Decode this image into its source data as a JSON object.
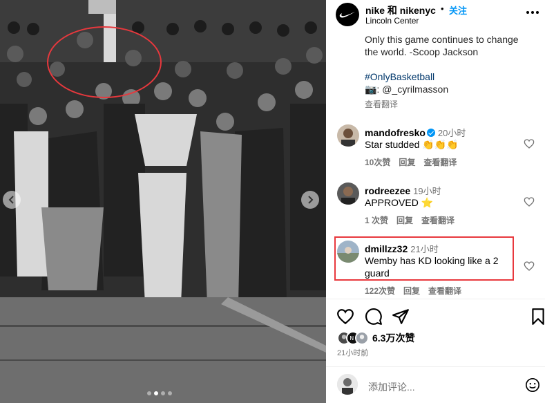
{
  "post": {
    "account": "nike 和 nikenyc",
    "separator": "•",
    "follow_label": "关注",
    "location": "Lincoln Center",
    "caption_lines": [
      "Only this game continues to change",
      "the world. -Scoop Jackson"
    ],
    "hashtag": "#OnlyBasketball",
    "photo_credit": "📷: @_cyrilmasson",
    "see_translation": "查看翻译"
  },
  "comments": [
    {
      "username": "mandofresko",
      "verified": true,
      "time": "20小时",
      "text": "Star studded 👏👏👏",
      "likes": "10次赞",
      "reply": "回复",
      "translate": "查看翻译"
    },
    {
      "username": "rodreezee",
      "verified": false,
      "time": "19小时",
      "text": "APPROVED ⭐",
      "likes": "1 次赞",
      "reply": "回复",
      "translate": "查看翻译"
    },
    {
      "username": "dmillzz32",
      "verified": false,
      "time": "21小时",
      "text": "Wemby has KD looking like a 2 guard",
      "likes": "122次赞",
      "reply": "回复",
      "translate": "查看翻译"
    }
  ],
  "engagement": {
    "likes": "6.3万次赞",
    "time_ago": "21小时前"
  },
  "add_comment": {
    "placeholder": "添加评论..."
  },
  "colors": {
    "link_blue": "#0095f6",
    "highlight_red": "#e8383d",
    "muted_gray": "#737373"
  },
  "icons": [
    "nike-swoosh-icon",
    "more-options-icon",
    "heart-icon",
    "comment-icon",
    "share-icon",
    "bookmark-icon",
    "emoji-icon",
    "chevron-left-icon",
    "chevron-right-icon"
  ],
  "carousel": {
    "dot_count": 4,
    "active_index": 1
  }
}
